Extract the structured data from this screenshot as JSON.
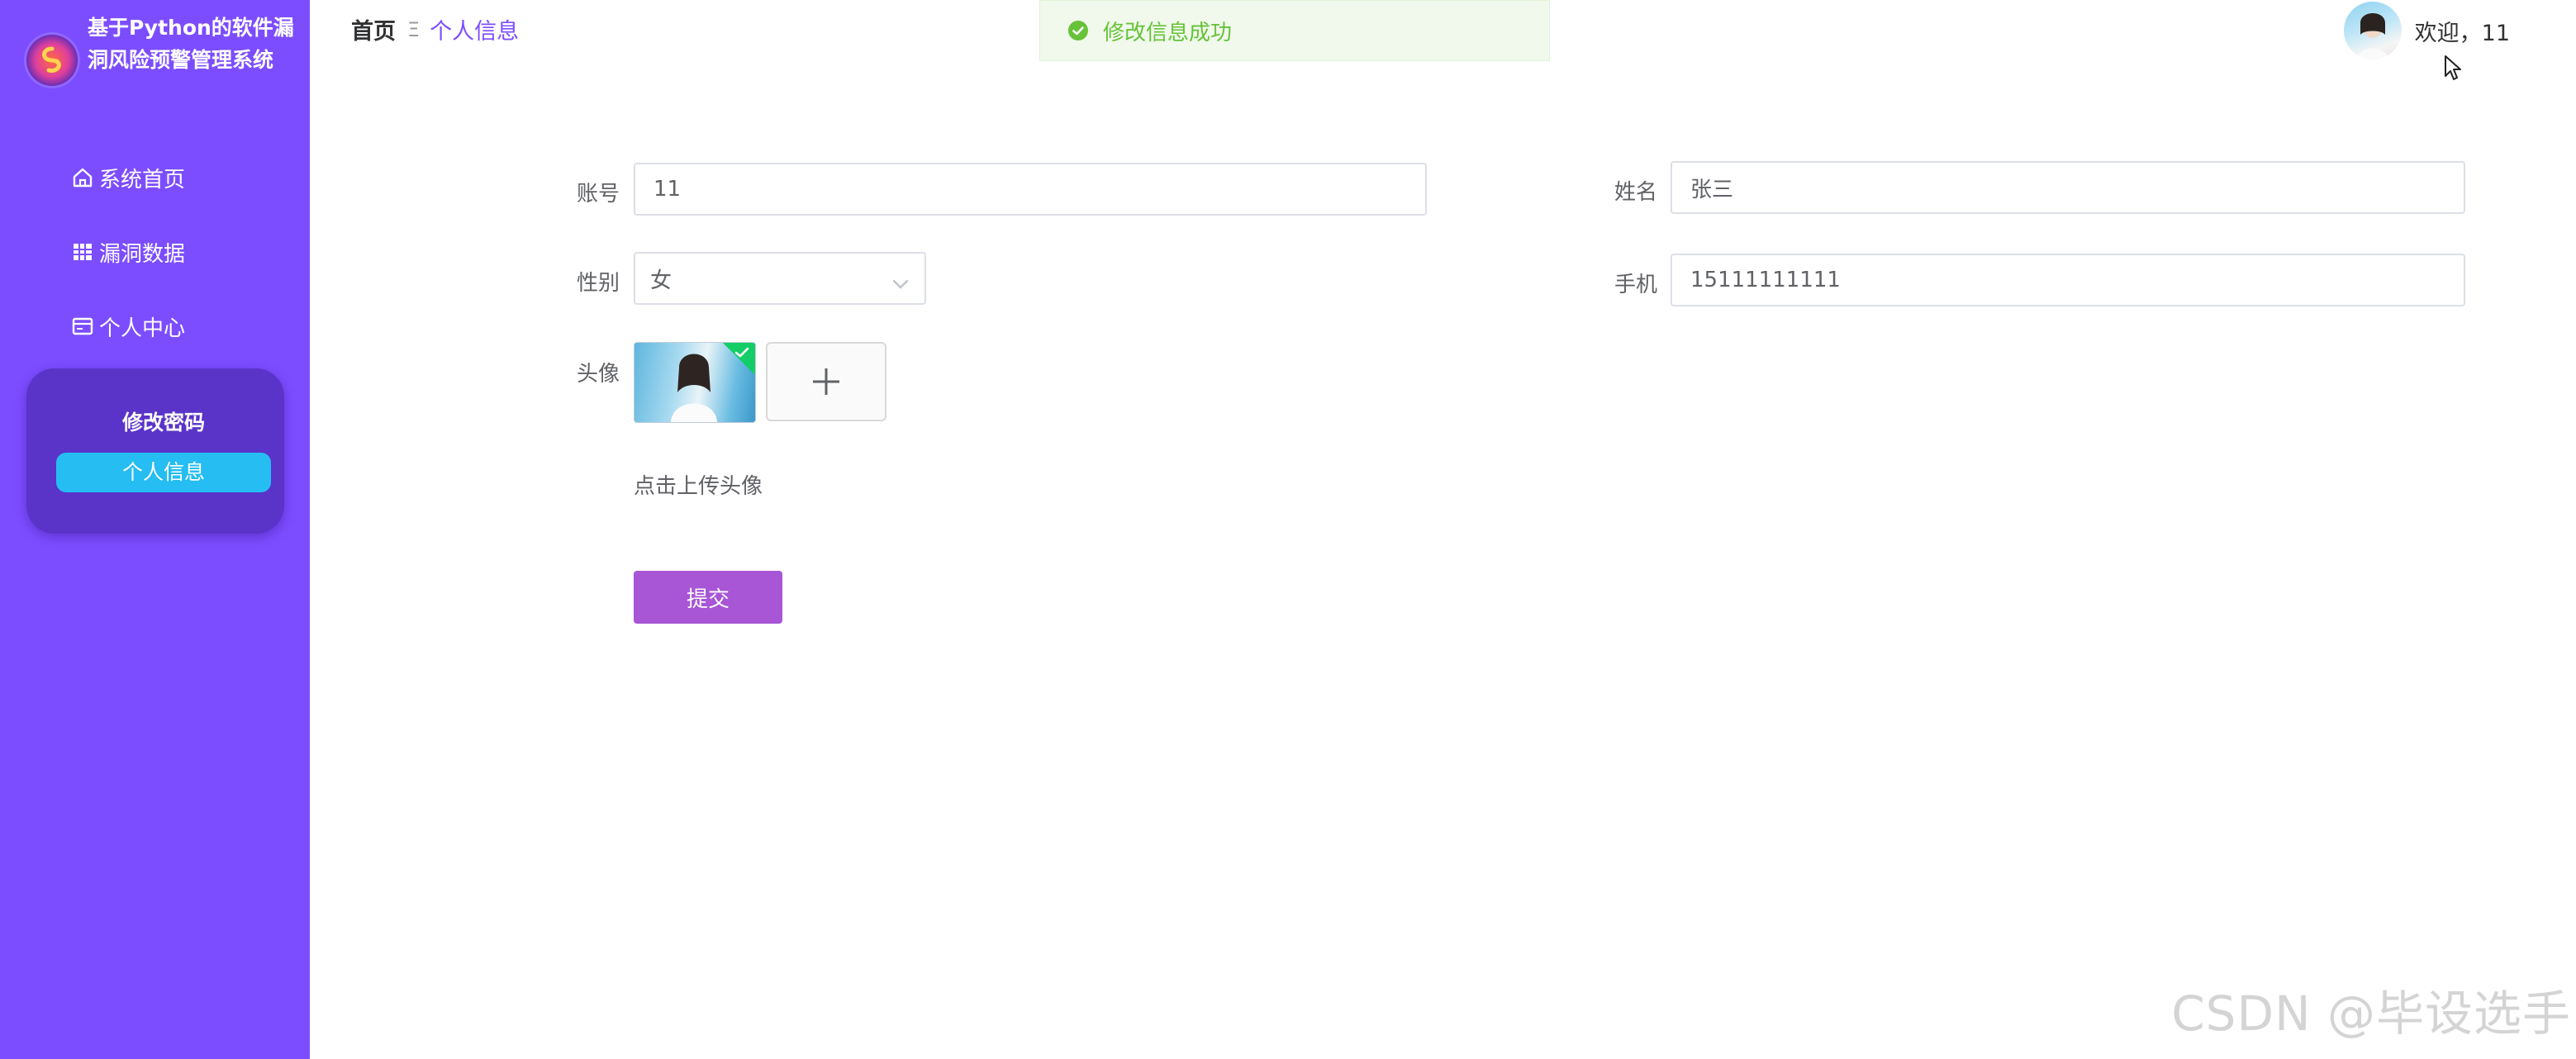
{
  "app": {
    "title": "基于Python的软件漏洞风险预警管理系统"
  },
  "sidebar": {
    "items": [
      {
        "label": "系统首页",
        "icon": "home-icon"
      },
      {
        "label": "漏洞数据",
        "icon": "grid-icon"
      },
      {
        "label": "个人中心",
        "icon": "card-icon"
      }
    ],
    "submenu": [
      {
        "label": "修改密码",
        "active": false
      },
      {
        "label": "个人信息",
        "active": true
      }
    ]
  },
  "header": {
    "breadcrumb_home": "首页",
    "breadcrumb_separator": "Ξ",
    "breadcrumb_current": "个人信息",
    "welcome": "欢迎，11"
  },
  "toast": {
    "message": "修改信息成功",
    "type": "success",
    "color": "#67c23a"
  },
  "form": {
    "account_label": "账号",
    "account_value": "11",
    "name_label": "姓名",
    "name_value": "张三",
    "gender_label": "性别",
    "gender_value": "女",
    "phone_label": "手机",
    "phone_value": "15111111111",
    "avatar_label": "头像",
    "upload_hint": "点击上传头像",
    "submit_label": "提交"
  },
  "colors": {
    "sidebar": "#7c4dff",
    "submenu_bg": "#5a33c9",
    "active_item": "#25bdf2",
    "submit_button": "#a855d6"
  },
  "watermark": "CSDN @毕设选手"
}
